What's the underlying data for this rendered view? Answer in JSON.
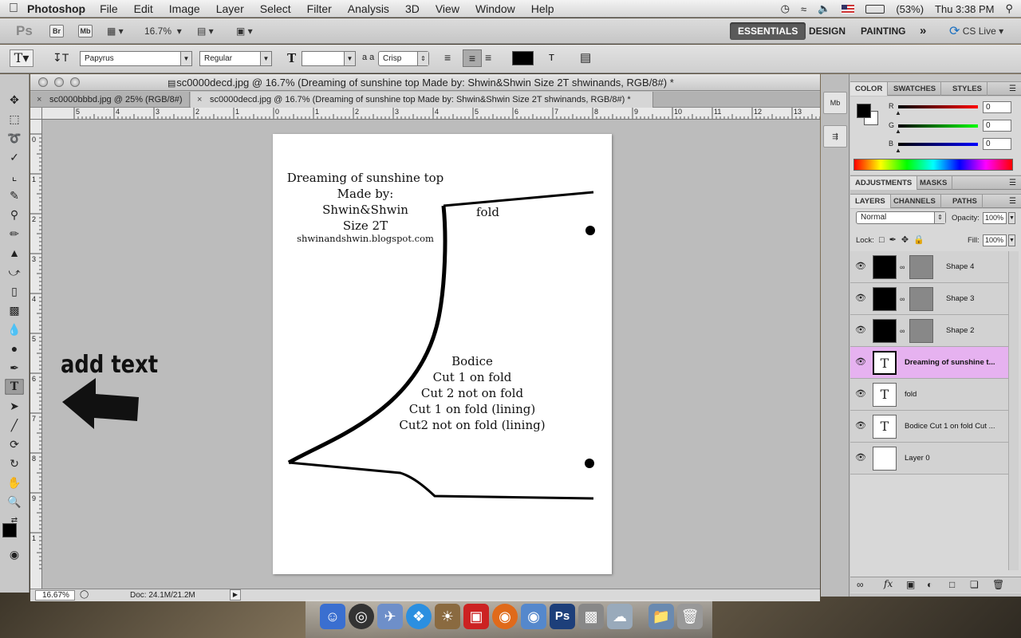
{
  "menubar": {
    "apple": "",
    "app": "Photoshop",
    "items": [
      "File",
      "Edit",
      "Image",
      "Layer",
      "Select",
      "Filter",
      "Analysis",
      "3D",
      "View",
      "Window",
      "Help"
    ],
    "battery": "(53%)",
    "clock": "Thu 3:38 PM"
  },
  "appbar": {
    "ps_logo": "Ps",
    "br": "Br",
    "mb": "Mb",
    "zoom": "16.7%",
    "workspaces": [
      "ESSENTIALS",
      "DESIGN",
      "PAINTING"
    ],
    "more": "»",
    "cslive": "CS Live"
  },
  "options": {
    "font_family": "Papyrus",
    "font_style": "Regular",
    "font_size": "",
    "aa_label": "a a",
    "antialias": "Crisp"
  },
  "document": {
    "title": "sc0000decd.jpg @ 16.7% (Dreaming of sunshine top Made by: Shwin&Shwin Size 2T shwinands, RGB/8#) *",
    "tabs": [
      "sc0000bbbd.jpg @ 25% (RGB/8#)",
      "sc0000decd.jpg @ 16.7% (Dreaming of sunshine top Made by: Shwin&Shwin Size 2T shwinands, RGB/8#) *"
    ],
    "ruler_h": [
      "5",
      "4",
      "3",
      "2",
      "1",
      "0",
      "1",
      "2",
      "3",
      "4",
      "5",
      "6",
      "7",
      "8",
      "9",
      "10",
      "11",
      "12",
      "13"
    ],
    "ruler_v": [
      "0",
      "1",
      "2",
      "3",
      "4",
      "5",
      "6",
      "7",
      "8",
      "9",
      "1"
    ],
    "pattern": {
      "title_lines": [
        "Dreaming of sunshine top",
        "Made by:",
        "Shwin&Shwin",
        "Size 2T",
        "shwinandshwin.blogspot.com"
      ],
      "fold": "fold",
      "bodice_lines": [
        "Bodice",
        "Cut 1 on fold",
        "Cut 2 not on fold",
        "Cut 1 on fold (lining)",
        "Cut2 not on fold (lining)"
      ]
    },
    "annotation": "add text"
  },
  "status": {
    "zoom": "16.67%",
    "doc": "Doc: 24.1M/21.2M"
  },
  "color_panel": {
    "tabs": [
      "COLOR",
      "SWATCHES",
      "STYLES"
    ],
    "channels": [
      {
        "label": "R",
        "value": "0",
        "color": "#cc2222"
      },
      {
        "label": "G",
        "value": "0",
        "color": "#33cc33"
      },
      {
        "label": "B",
        "value": "0",
        "color": "#2222cc"
      }
    ]
  },
  "adjust_panel": {
    "tabs": [
      "ADJUSTMENTS",
      "MASKS"
    ]
  },
  "layers_panel": {
    "tabs": [
      "LAYERS",
      "CHANNELS",
      "PATHS"
    ],
    "blend_mode": "Normal",
    "opacity_label": "Opacity:",
    "opacity": "100%",
    "lock_label": "Lock:",
    "fill_label": "Fill:",
    "fill": "100%",
    "layers": [
      {
        "name": "Shape 4",
        "type": "shape"
      },
      {
        "name": "Shape 3",
        "type": "shape"
      },
      {
        "name": "Shape 2",
        "type": "shape"
      },
      {
        "name": "Dreaming of sunshine t...",
        "type": "text",
        "active": true
      },
      {
        "name": "fold",
        "type": "text"
      },
      {
        "name": "Bodice Cut 1 on fold Cut ...",
        "type": "text"
      },
      {
        "name": "Layer 0",
        "type": "image"
      }
    ]
  },
  "colors": {
    "highlight": "#e6b2f0",
    "workspace_active": "#5a5a5a"
  }
}
